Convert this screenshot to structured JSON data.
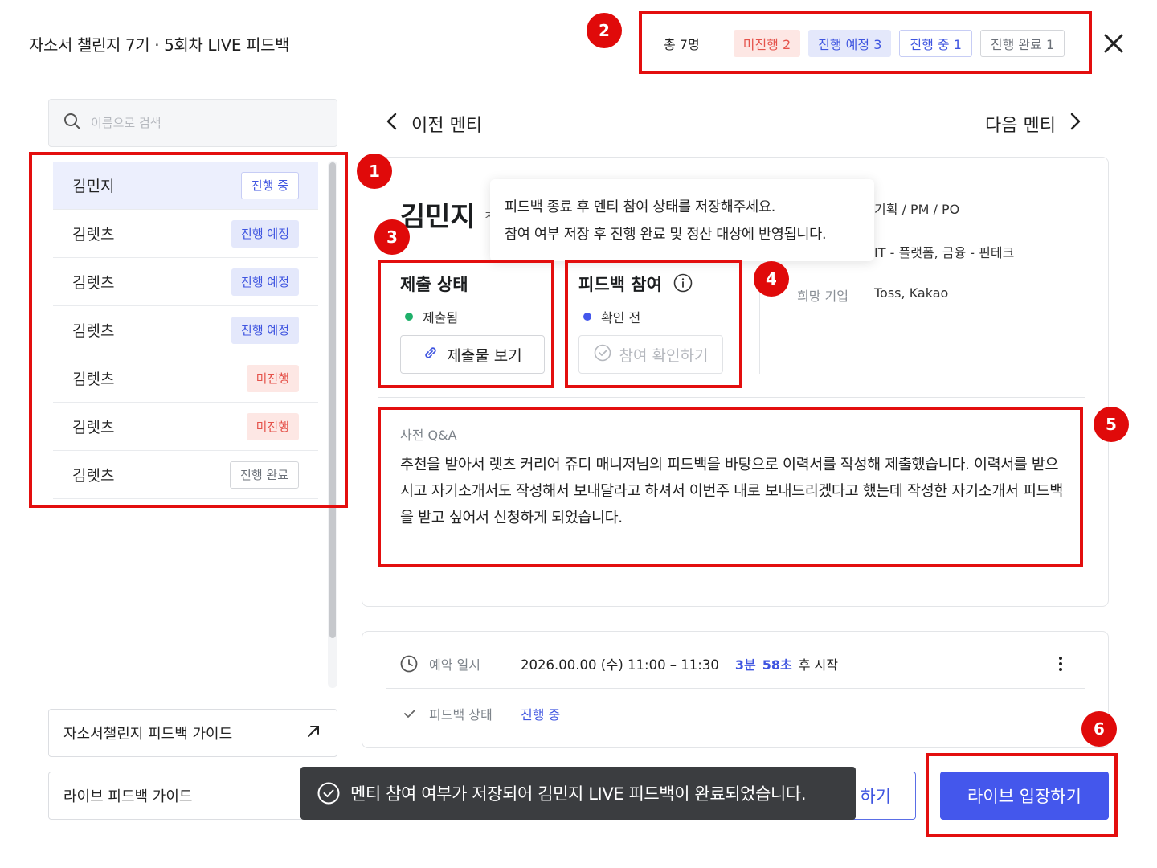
{
  "header": {
    "title": "자소서 챌린지 7기 · 5회차 LIVE 피드백"
  },
  "status_summary": {
    "total": "총 7명",
    "chips": [
      {
        "label": "미진행 2"
      },
      {
        "label": "진행 예정 3"
      },
      {
        "label": "진행 중 1"
      },
      {
        "label": "진행 완료 1"
      }
    ]
  },
  "search": {
    "placeholder": "이름으로 검색"
  },
  "mentees": [
    {
      "name": "김민지",
      "status": "진행 중"
    },
    {
      "name": "김렛츠",
      "status": "진행 예정"
    },
    {
      "name": "김렛츠",
      "status": "진행 예정"
    },
    {
      "name": "김렛츠",
      "status": "진행 예정"
    },
    {
      "name": "김렛츠",
      "status": "미진행"
    },
    {
      "name": "김렛츠",
      "status": "미진행"
    },
    {
      "name": "김렛츠",
      "status": "진행 완료"
    }
  ],
  "guides": {
    "essay": "자소서챌린지 피드백 가이드",
    "live": "라이브 피드백 가이드"
  },
  "nav": {
    "prev": "이전 멘티",
    "next": "다음 멘티"
  },
  "detail": {
    "name": "김민지",
    "name_fragment": "ㅈ",
    "tooltip_line1": "피드백 종료 후 멘티 참여 상태를 저장해주세요.",
    "tooltip_line2": "참여 여부 저장 후 진행 완료 및 정산 대상에 반영됩니다.",
    "job": "기획 / PM / PO",
    "industry": "IT - 플랫폼, 금융 - 핀테크",
    "company_label": "희망 기업",
    "company_value": "Toss, Kakao",
    "submission": {
      "title": "제출 상태",
      "status": "제출됨",
      "status_color": "#1fb06a",
      "button": "제출물 보기"
    },
    "participation": {
      "title": "피드백 참여",
      "status": "확인 전",
      "status_color": "#4457ec",
      "button": "참여 확인하기"
    },
    "qa_label": "사전 Q&A",
    "qa_text": "추천을 받아서 렛츠 커리어 쥬디 매니저님의 피드백을 바탕으로 이력서를 작성해 제출했습니다. 이력서를 받으시고 자기소개서도 작성해서 보내달라고 하셔서 이번주 내로 보내드리겠다고 했는데 작성한 자기소개서 피드백을 받고 싶어서 신청하게 되었습니다."
  },
  "schedule": {
    "reserve_label": "예약 일시",
    "reserve_value": "2026.00.00 (수) 11:00 – 11:30",
    "countdown_min": "3분",
    "countdown_sec": "58초",
    "countdown_suffix": "후 시작",
    "status_label": "피드백 상태",
    "status_value": "진행 중"
  },
  "actions": {
    "secondary": "하기",
    "primary": "라이브 입장하기"
  },
  "toast": {
    "message": "멘티 참여 여부가 저장되어 김민지 LIVE 피드백이 완료되었습니다."
  },
  "annotations": [
    "1",
    "2",
    "3",
    "4",
    "5",
    "6"
  ],
  "colors": {
    "accent": "#4457ec",
    "annotation": "#e30e0e",
    "success": "#1fb06a",
    "danger": "#e5534b"
  }
}
